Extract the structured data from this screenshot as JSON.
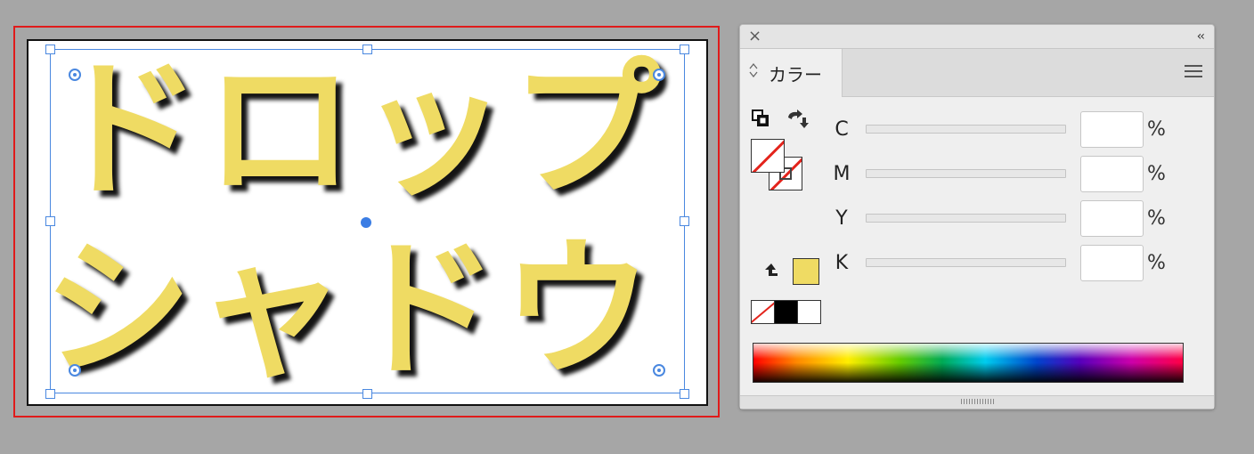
{
  "canvas": {
    "line1": "ドロップ",
    "line2": "シャドウ",
    "text_fill_color": "#efdb63",
    "selection_color": "#4a88e0",
    "bleed_color": "#e01b1b"
  },
  "color_panel": {
    "close_icon": "×",
    "collapse_icon": "‹‹",
    "tab_label": "カラー",
    "tab_arrows_icon": "⇕",
    "menu_icon": "hamburger-icon",
    "channels": [
      {
        "label": "C",
        "value": "",
        "unit": "%"
      },
      {
        "label": "M",
        "value": "",
        "unit": "%"
      },
      {
        "label": "Y",
        "value": "",
        "unit": "%"
      },
      {
        "label": "K",
        "value": "",
        "unit": "%"
      }
    ],
    "out_of_gamut_swatch_color": "#efdb63",
    "quick_swatches": [
      "none",
      "black",
      "white"
    ]
  }
}
